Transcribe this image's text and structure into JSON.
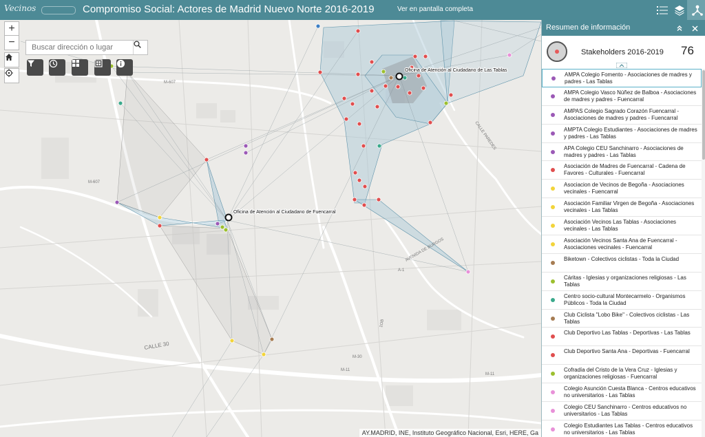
{
  "header": {
    "logo_text": "Vecinos",
    "title": "Compromiso Social: Actores de Madrid Nuevo Norte 2016-2019",
    "fullscreen_link": "Ver en pantalla completa",
    "buttons": [
      {
        "name": "legend-list-icon"
      },
      {
        "name": "layers-icon"
      },
      {
        "name": "network-icon"
      }
    ]
  },
  "map": {
    "zoom_in": "+",
    "zoom_out": "−",
    "search_placeholder": "Buscar dirección o lugar",
    "tools": [
      {
        "name": "filter-icon"
      },
      {
        "name": "history-icon"
      },
      {
        "name": "grid-icon"
      },
      {
        "name": "layout-icon"
      },
      {
        "name": "info-icon"
      }
    ],
    "offices": [
      {
        "label": "Oficina de Atención al Ciudadano de Las Tablas"
      },
      {
        "label": "Oficina de Atención al Ciudadano de Fuencarral"
      }
    ],
    "road_labels": [
      "M-607",
      "M-607",
      "CALLE 30",
      "M-30",
      "M-11",
      "A-1",
      "M-11",
      "CALLE PAREDES",
      "AVENIDA DE BURGOS",
      "1OB"
    ],
    "colors": {
      "asociaciones_madres_padres": "#9b59b6",
      "asociaciones_vecinales": "#f2d43a",
      "deportivas_y_cultura": "#e04e4e",
      "ciclistas": "#a67c52",
      "religiosas": "#9cbf2f",
      "organismos_publicos": "#3aa98b",
      "centros_educativos": "#e891d8",
      "network_fill": "#a9c8d8",
      "network_line": "#5f93aa"
    },
    "attribution": "AY.MADRID, INE, Instituto Geográfico Nacional, Esri, HERE, Ga"
  },
  "panel": {
    "title": "Resumen de información",
    "summary": {
      "label": "Stakeholders 2016-2019",
      "count": "76"
    },
    "items": [
      {
        "label": "AMPA Colegio Fomento - Asociaciones de madres y padres - Las Tablas",
        "color": "#9b59b6",
        "selected": true
      },
      {
        "label": "AMPA Colegio Vasco Núñez de Balboa - Asociaciones de madres y padres - Fuencarral",
        "color": "#9b59b6"
      },
      {
        "label": "AMPAS Colegio Sagrado Corazón Fuencarral - Asociaciones de madres y padres - Fuencarral",
        "color": "#9b59b6"
      },
      {
        "label": "AMPTA Colegio Estudiantes - Asociaciones de madres y padres - Las Tablas",
        "color": "#9b59b6"
      },
      {
        "label": "APA Colegio CEU Sanchinarro - Asociaciones de madres y padres - Las Tablas",
        "color": "#9b59b6"
      },
      {
        "label": "Asociación de Madres de Fuencarral - Cadena de Favores - Culturales - Fuencarral",
        "color": "#e04e4e"
      },
      {
        "label": "Asociacion de Vecinos de Begoña - Asociaciones vecinales - Fuencarral",
        "color": "#f2d43a"
      },
      {
        "label": "Asociación Familiar Virgen de Begoña - Asociaciones vecinales - Las Tablas",
        "color": "#f2d43a"
      },
      {
        "label": "Asociación Vecinos Las Tablas - Asociaciones vecinales - Las Tablas",
        "color": "#f2d43a"
      },
      {
        "label": "Asociación Vecinos Santa Ana de Fuencarral - Asociaciones vecinales - Fuencarral",
        "color": "#f2d43a"
      },
      {
        "label": "Biketown - Colectivos ciclistas - Toda la Ciudad",
        "color": "#a67c52"
      },
      {
        "label": "Cáritas - Iglesias y organizaciones religiosas - Las Tablas",
        "color": "#9cbf2f"
      },
      {
        "label": "Centro socio-cultural Montecarmelo - Organismos Públicos - Toda la Ciudad",
        "color": "#3aa98b"
      },
      {
        "label": "Club Ciclista \"Lobo Bike\" - Colectivos ciclistas - Las Tablas",
        "color": "#a67c52"
      },
      {
        "label": "Club Deportivo Las Tablas - Deportivas - Las Tablas",
        "color": "#e04e4e"
      },
      {
        "label": "Club Deportivo Santa Ana - Deportivas - Fuencarral",
        "color": "#e04e4e"
      },
      {
        "label": "Cofradía del Cristo de la Vera Cruz - Iglesias y organizaciones religiosas - Fuencarral",
        "color": "#9cbf2f"
      },
      {
        "label": "Colegio Asunción Cuesta Blanca - Centros educativos no universitarios - Las Tablas",
        "color": "#e891d8"
      },
      {
        "label": "Colegio CEU Sanchinarro - Centros educativos no universitarios - Las Tablas",
        "color": "#e891d8"
      },
      {
        "label": "Colegio Estudiantes Las Tablas - Centros educativos no universitarios - Las Tablas",
        "color": "#e891d8"
      }
    ]
  }
}
